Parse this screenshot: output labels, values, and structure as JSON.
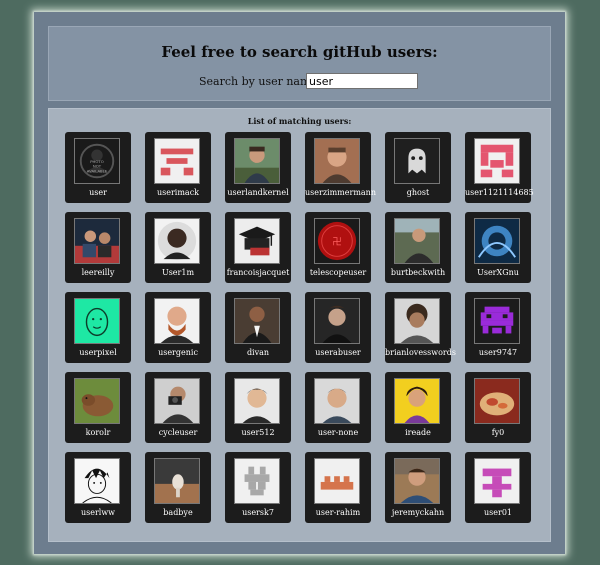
{
  "header": {
    "title": "Feel free to search gitHub users:",
    "search_label": "Search by user name:",
    "search_value": "user"
  },
  "results": {
    "title": "List of matching users:",
    "users": [
      {
        "login": "user",
        "avatar": "no-photo-icon"
      },
      {
        "login": "userimack",
        "avatar": "identicon-red"
      },
      {
        "login": "userlandkernel",
        "avatar": "photo-outdoor"
      },
      {
        "login": "userzimmermann",
        "avatar": "photo-portrait"
      },
      {
        "login": "ghost",
        "avatar": "ghost-icon"
      },
      {
        "login": "user1121114685",
        "avatar": "identicon-pink"
      },
      {
        "login": "leereilly",
        "avatar": "photo-group"
      },
      {
        "login": "User1m",
        "avatar": "photo-circle-portrait"
      },
      {
        "login": "francoisjacquet",
        "avatar": "graduation-icon"
      },
      {
        "login": "telescopeuser",
        "avatar": "red-seal-icon"
      },
      {
        "login": "burtbeckwith",
        "avatar": "photo-man-outdoor"
      },
      {
        "login": "UserXGnu",
        "avatar": "photo-blue-abstract"
      },
      {
        "login": "userpixel",
        "avatar": "pixel-face-icon"
      },
      {
        "login": "usergenic",
        "avatar": "photo-bald-man"
      },
      {
        "login": "divan",
        "avatar": "photo-suit-man"
      },
      {
        "login": "userabuser",
        "avatar": "photo-dark-portrait"
      },
      {
        "login": "brianlovesswords",
        "avatar": "photo-curly-hair"
      },
      {
        "login": "user9747",
        "avatar": "identicon-purple-invader"
      },
      {
        "login": "korolr",
        "avatar": "photo-capybara"
      },
      {
        "login": "cycleuser",
        "avatar": "photo-camera-man"
      },
      {
        "login": "user512",
        "avatar": "photo-asian-man"
      },
      {
        "login": "user-none",
        "avatar": "photo-smiling-man"
      },
      {
        "login": "ireade",
        "avatar": "cartoon-yellow"
      },
      {
        "login": "fy0",
        "avatar": "photo-food"
      },
      {
        "login": "userlww",
        "avatar": "anime-drawing"
      },
      {
        "login": "badbye",
        "avatar": "photo-dark-object"
      },
      {
        "login": "usersk7",
        "avatar": "identicon-gray"
      },
      {
        "login": "user-rahim",
        "avatar": "identicon-orange"
      },
      {
        "login": "jeremyckahn",
        "avatar": "photo-outdoor-man"
      },
      {
        "login": "user01",
        "avatar": "identicon-magenta"
      }
    ]
  },
  "colors": {
    "background": "#4e6b60",
    "frame": "#6d7d8e",
    "search_panel": "#8493a4",
    "results_panel": "#a6b1bd",
    "card": "#1c1c1c"
  }
}
